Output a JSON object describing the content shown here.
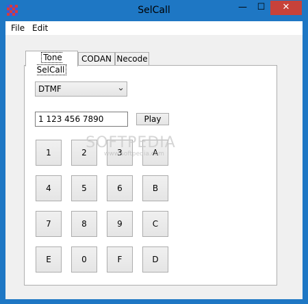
{
  "window": {
    "title": "SelCall",
    "minimize_glyph": "—",
    "maximize_glyph": "☐",
    "close_glyph": "✕"
  },
  "app_icon": {
    "name": "selcall-app-icon",
    "colors": [
      "#3b5bd6",
      "#d63b3b",
      "#3b5bd6",
      "#d63b3b",
      "#d63b3b",
      "#3b5bd6",
      "#d63b3b",
      "#3b5bd6",
      "#3b5bd6",
      "#d63b3b",
      "#3b5bd6",
      "#d63b3b",
      "#d63b3b",
      "#3b5bd6",
      "#d63b3b",
      "#3b5bd6"
    ]
  },
  "menu": {
    "items": [
      {
        "label": "File"
      },
      {
        "label": "Edit"
      }
    ]
  },
  "tabs": [
    {
      "label": "Tone SelCall",
      "active": true
    },
    {
      "label": "CODAN",
      "active": false
    },
    {
      "label": "Necode",
      "active": false
    }
  ],
  "tone_panel": {
    "mode_select": {
      "value": "DTMF",
      "chevron": "⌄"
    },
    "number_field": {
      "value": "1 123 456 7890"
    },
    "play_button": {
      "label": "Play"
    },
    "keypad": [
      [
        "1",
        "2",
        "3",
        "A"
      ],
      [
        "4",
        "5",
        "6",
        "B"
      ],
      [
        "7",
        "8",
        "9",
        "C"
      ],
      [
        "E",
        "0",
        "F",
        "D"
      ]
    ]
  },
  "watermark": {
    "text": "SOFTPEDIA",
    "sub": "www.softpedia.com"
  }
}
